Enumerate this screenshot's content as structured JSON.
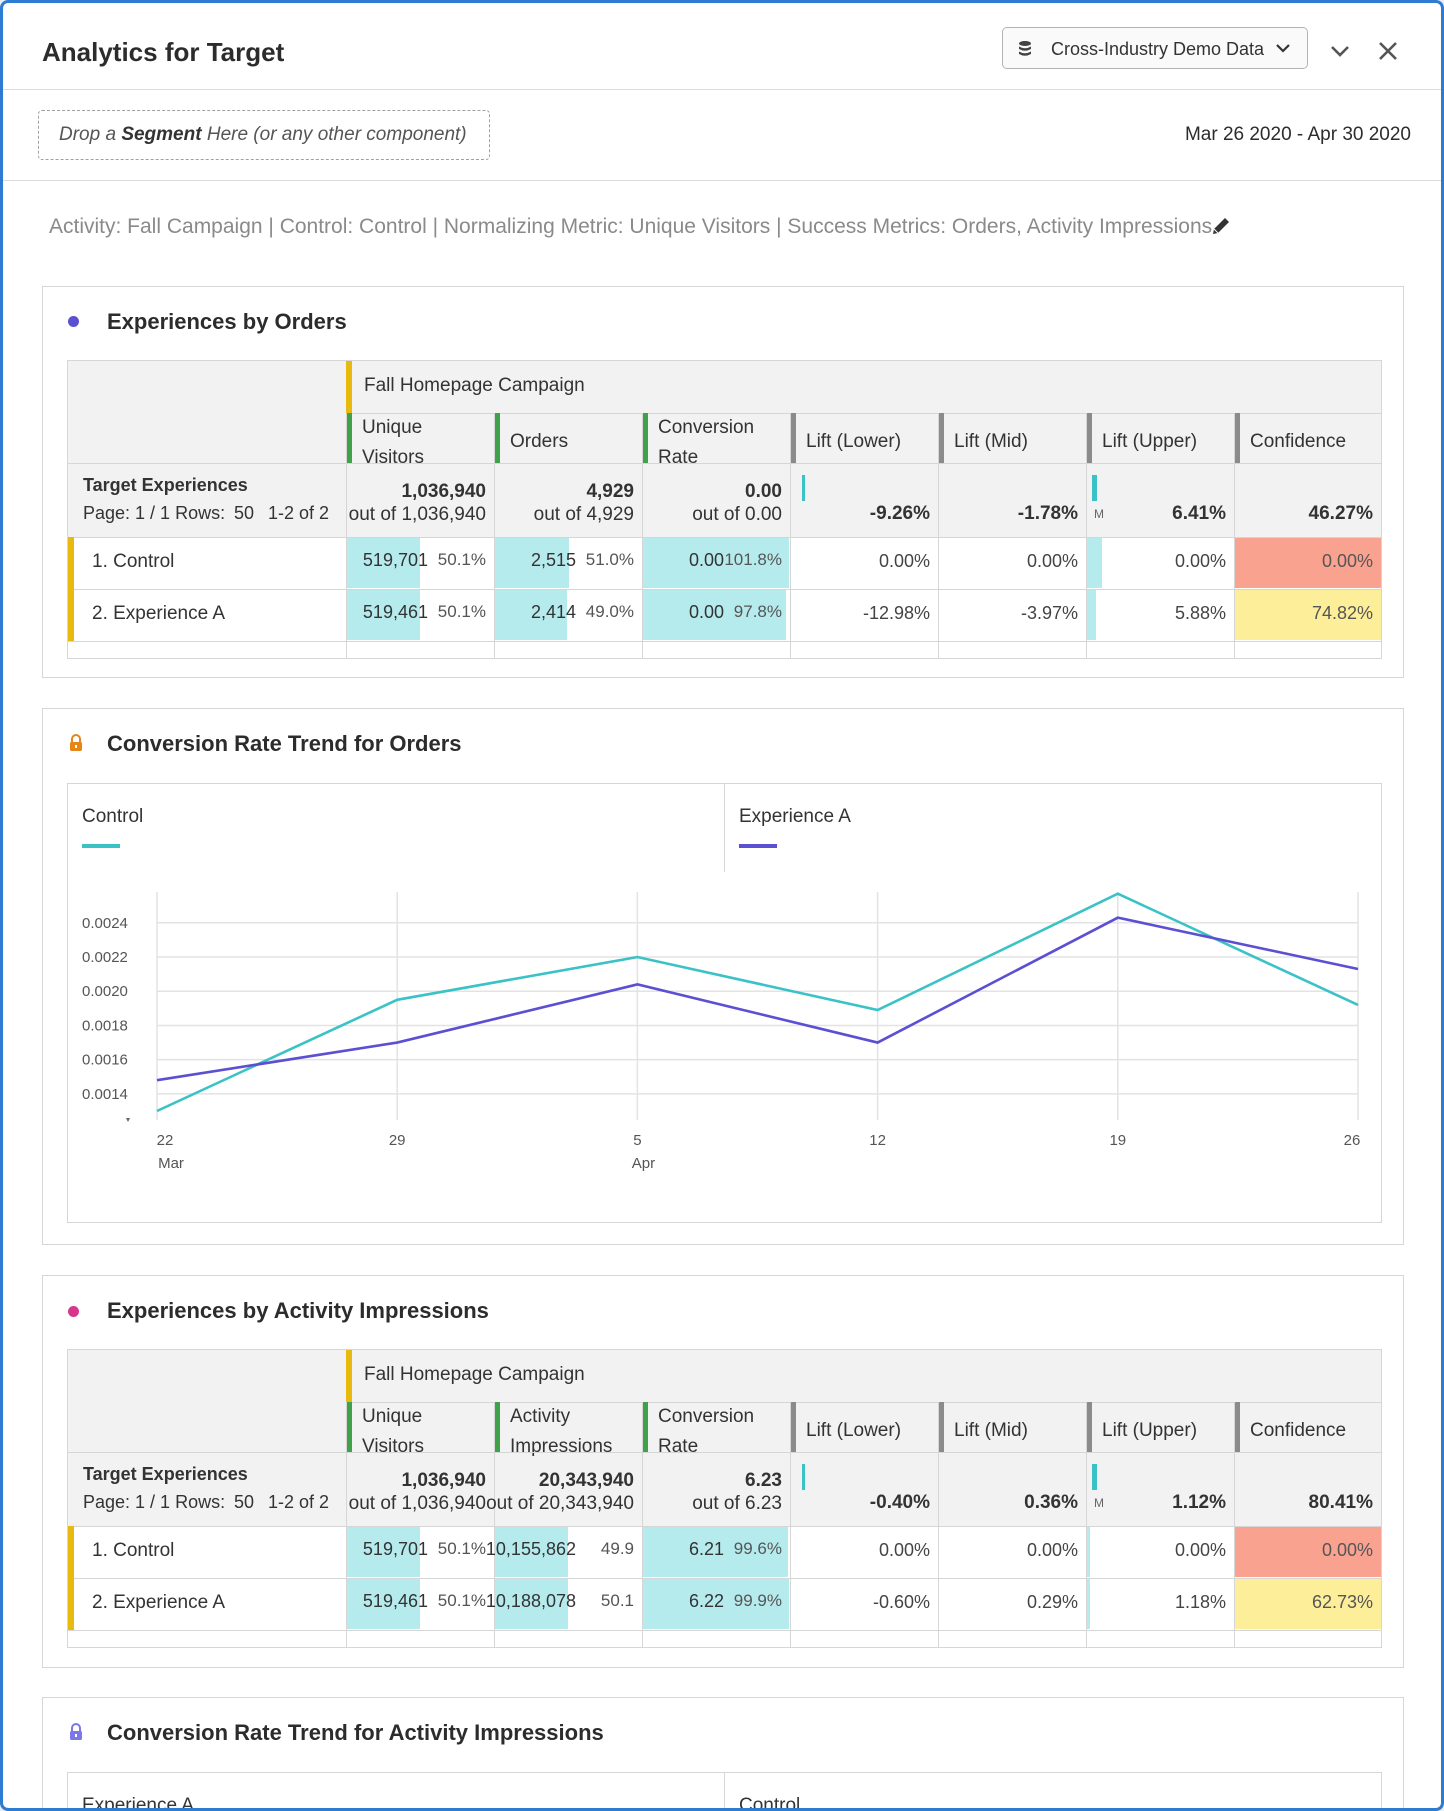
{
  "app_title": "Analytics for Target",
  "data_source": "Cross-Industry Demo Data",
  "segment_drop": {
    "prefix": "Drop a ",
    "bold": "Segment",
    "suffix": " Here (or any other component)"
  },
  "date_range": "Mar 26 2020 - Apr 30 2020",
  "description": "Activity: Fall Campaign | Control: Control | Normalizing Metric: Unique Visitors | Success Metrics: Orders, Activity Impressions",
  "colors": {
    "accent": "#2d7cd1",
    "teal": "#3ac2c6",
    "purple": "#5b4fd2",
    "bar": "#b6ebee",
    "confidence_red": "#f9a290",
    "confidence_yellow": "#fdee9a",
    "strip_yellow": "#e8b90f",
    "strip_green": "#3fa24a",
    "strip_gray": "#8b8b8b"
  },
  "panel1": {
    "title": "Experiences by Orders",
    "group_header": "Fall Homepage Campaign",
    "dim_title": "Target Experiences",
    "page_text": "Page: 1 / 1 Rows:",
    "rows_value": "50",
    "range_text": "1-2 of 2",
    "columns": [
      {
        "l1": "Unique",
        "l2": "Visitors"
      },
      {
        "l1": "Orders",
        "l2": ""
      },
      {
        "l1": "Conversion",
        "l2": "Rate"
      },
      {
        "l1": "Lift (Lower)",
        "l2": ""
      },
      {
        "l1": "Lift (Mid)",
        "l2": ""
      },
      {
        "l1": "Lift (Upper)",
        "l2": ""
      },
      {
        "l1": "Confidence",
        "l2": ""
      }
    ],
    "totals": {
      "uv": "1,036,940",
      "uv_sub": "out of 1,036,940",
      "m": "4,929",
      "m_sub": "out of 4,929",
      "cr": "0.00",
      "cr_sub": "out of 0.00",
      "lo": "-9.26%",
      "mid": "-1.78%",
      "up": "6.41%",
      "conf": "46.27%",
      "mini": "M"
    },
    "rows": [
      {
        "name": "1. Control",
        "uv": "519,701",
        "uv_pct": "50.1%",
        "uv_frac": 0.501,
        "m": "2,515",
        "m_pct": "51.0%",
        "m_frac": 0.51,
        "cr": "0.00",
        "cr_pct": "101.8%",
        "cr_frac": 1.0,
        "lo": "0.00%",
        "mid": "0.00%",
        "up": "0.00%",
        "up_frac": 0.1,
        "conf": "0.00%",
        "conf_color": "red"
      },
      {
        "name": "2. Experience A",
        "uv": "519,461",
        "uv_pct": "50.1%",
        "uv_frac": 0.501,
        "m": "2,414",
        "m_pct": "49.0%",
        "m_frac": 0.49,
        "cr": "0.00",
        "cr_pct": "97.8%",
        "cr_frac": 0.978,
        "lo": "-12.98%",
        "mid": "-3.97%",
        "up": "5.88%",
        "up_frac": 0.06,
        "conf": "74.82%",
        "conf_color": "yellow"
      }
    ]
  },
  "panel2": {
    "title": "Conversion Rate Trend for Orders",
    "legend": [
      "Control",
      "Experience A"
    ],
    "chart_data": {
      "type": "line",
      "x": [
        "22 Mar",
        "29",
        "5 Apr",
        "12",
        "19",
        "26"
      ],
      "x_tick_labels": [
        [
          "22",
          "Mar"
        ],
        [
          "29",
          ""
        ],
        [
          "5",
          "Apr"
        ],
        [
          "12",
          ""
        ],
        [
          "19",
          ""
        ],
        [
          "26",
          ""
        ]
      ],
      "series": [
        {
          "name": "Control",
          "color": "#3ac2c6",
          "values": [
            0.0013,
            0.00195,
            0.0022,
            0.00189,
            0.00257,
            0.00192
          ]
        },
        {
          "name": "Experience A",
          "color": "#5b4fd2",
          "values": [
            0.00148,
            0.0017,
            0.00204,
            0.0017,
            0.00243,
            0.00213
          ]
        }
      ],
      "yticks": [
        "0.0024",
        "0.0022",
        "0.0020",
        "0.0018",
        "0.0016",
        "0.0014"
      ],
      "ylim": [
        0.0013,
        0.00258
      ],
      "grid": true
    }
  },
  "panel3": {
    "title": "Experiences by Activity Impressions",
    "group_header": "Fall Homepage Campaign",
    "dim_title": "Target Experiences",
    "page_text": "Page: 1 / 1 Rows:",
    "rows_value": "50",
    "range_text": "1-2 of 2",
    "columns": [
      {
        "l1": "Unique",
        "l2": "Visitors"
      },
      {
        "l1": "Activity",
        "l2": "Impressions"
      },
      {
        "l1": "Conversion",
        "l2": "Rate"
      },
      {
        "l1": "Lift (Lower)",
        "l2": ""
      },
      {
        "l1": "Lift (Mid)",
        "l2": ""
      },
      {
        "l1": "Lift (Upper)",
        "l2": ""
      },
      {
        "l1": "Confidence",
        "l2": ""
      }
    ],
    "totals": {
      "uv": "1,036,940",
      "uv_sub": "out of 1,036,940",
      "m": "20,343,940",
      "m_sub": "out of 20,343,940",
      "cr": "6.23",
      "cr_sub": "out of 6.23",
      "lo": "-0.40%",
      "mid": "0.36%",
      "up": "1.12%",
      "conf": "80.41%",
      "mini": "M"
    },
    "rows": [
      {
        "name": "1. Control",
        "uv": "519,701",
        "uv_pct": "50.1%",
        "uv_frac": 0.501,
        "m": "10,155,862",
        "m_pct": "49.9",
        "m_frac": 0.499,
        "cr": "6.21",
        "cr_pct": "99.6%",
        "cr_frac": 0.996,
        "lo": "0.00%",
        "mid": "0.00%",
        "up": "0.00%",
        "up_frac": 0,
        "conf": "0.00%",
        "conf_color": "red"
      },
      {
        "name": "2. Experience A",
        "uv": "519,461",
        "uv_pct": "50.1%",
        "uv_frac": 0.501,
        "m": "10,188,078",
        "m_pct": "50.1",
        "m_frac": 0.501,
        "cr": "6.22",
        "cr_pct": "99.9%",
        "cr_frac": 0.999,
        "lo": "-0.60%",
        "mid": "0.29%",
        "up": "1.18%",
        "up_frac": 0,
        "conf": "62.73%",
        "conf_color": "yellow"
      }
    ]
  },
  "panel4": {
    "title": "Conversion Rate Trend for Activity Impressions",
    "legend": [
      "Experience A",
      "Control"
    ]
  }
}
